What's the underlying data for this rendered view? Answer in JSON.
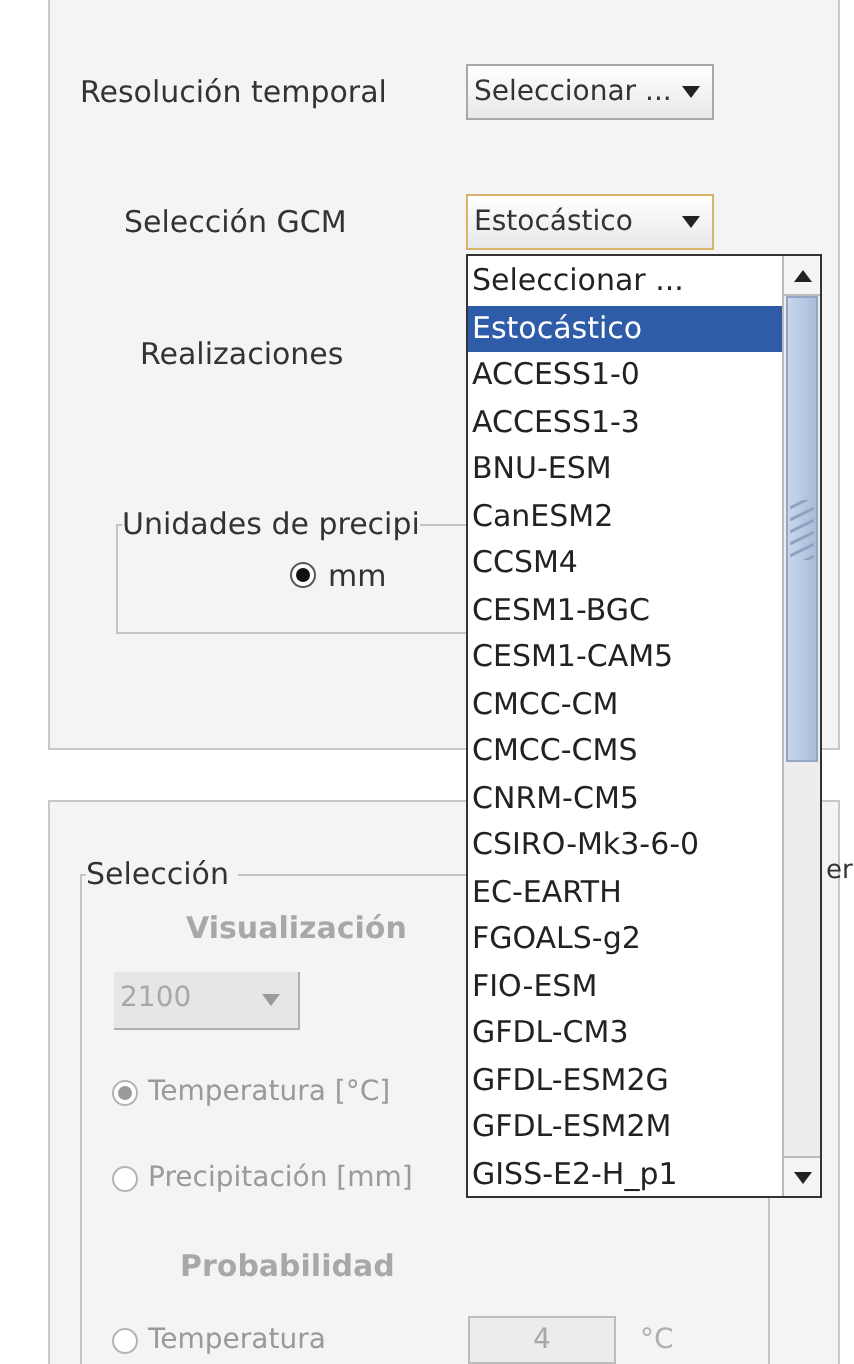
{
  "top_panel": {
    "fields": [
      {
        "label": "Resolución temporal",
        "value": "Seleccionar ...",
        "focused": false
      },
      {
        "label": "Selección GCM",
        "value": "Estocástico",
        "focused": true
      },
      {
        "label": "Realizaciones"
      }
    ],
    "units_group": {
      "title": "Unidades de precipi",
      "options": [
        {
          "label": "mm",
          "selected": true
        }
      ]
    }
  },
  "dropdown": {
    "items": [
      {
        "label": "Seleccionar ...",
        "selected": false
      },
      {
        "label": "Estocástico",
        "selected": true
      },
      {
        "label": "ACCESS1-0",
        "selected": false
      },
      {
        "label": "ACCESS1-3",
        "selected": false
      },
      {
        "label": "BNU-ESM",
        "selected": false
      },
      {
        "label": "CanESM2",
        "selected": false
      },
      {
        "label": "CCSM4",
        "selected": false
      },
      {
        "label": "CESM1-BGC",
        "selected": false
      },
      {
        "label": "CESM1-CAM5",
        "selected": false
      },
      {
        "label": "CMCC-CM",
        "selected": false
      },
      {
        "label": "CMCC-CMS",
        "selected": false
      },
      {
        "label": "CNRM-CM5",
        "selected": false
      },
      {
        "label": "CSIRO-Mk3-6-0",
        "selected": false
      },
      {
        "label": "EC-EARTH",
        "selected": false
      },
      {
        "label": "FGOALS-g2",
        "selected": false
      },
      {
        "label": "FIO-ESM",
        "selected": false
      },
      {
        "label": "GFDL-CM3",
        "selected": false
      },
      {
        "label": "GFDL-ESM2G",
        "selected": false
      },
      {
        "label": "GFDL-ESM2M",
        "selected": false
      },
      {
        "label": "GISS-E2-H_p1",
        "selected": false
      }
    ]
  },
  "bottom_panel": {
    "group": {
      "title": "Selección",
      "visualization_heading": "Visualización",
      "year_combo": {
        "value": "2100",
        "disabled": true
      },
      "variables": [
        {
          "label": "Temperatura [°C]",
          "selected": true,
          "disabled": true
        },
        {
          "label": "Precipitación [mm]",
          "selected": false,
          "disabled": true
        }
      ],
      "probability_heading": "Probabilidad",
      "threshold": {
        "label": "Temperatura",
        "value": "4",
        "unit": "°C",
        "selected": false,
        "disabled": true
      }
    },
    "side_group_title": "er"
  }
}
